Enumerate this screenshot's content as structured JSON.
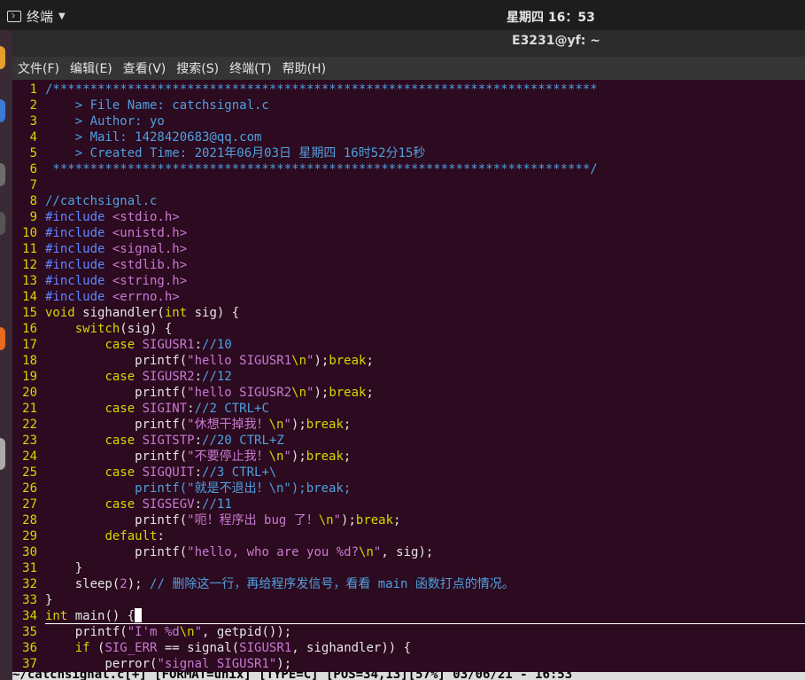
{
  "topbar": {
    "app_label": "终端",
    "clock": "星期四 16：53"
  },
  "window": {
    "title": "E3231@yf: ~"
  },
  "menu": [
    "文件(F)",
    "编辑(E)",
    "查看(V)",
    "搜索(S)",
    "终端(T)",
    "帮助(H)"
  ],
  "colors": {
    "comment": "#4fa0e0",
    "preproc": "#5f87ff",
    "string": "#c87ad2",
    "keyword": "#d7d700",
    "type": "#5fafff",
    "plain": "#e6e6e6",
    "linenum": "#d7d700"
  },
  "editor": {
    "lines": [
      {
        "n": "1",
        "t": [
          {
            "c": "comment",
            "s": "/*************************************************************************"
          }
        ]
      },
      {
        "n": "2",
        "t": [
          {
            "c": "comment",
            "s": "    > File Name: catchsignal.c"
          }
        ]
      },
      {
        "n": "3",
        "t": [
          {
            "c": "comment",
            "s": "    > Author: yo"
          }
        ]
      },
      {
        "n": "4",
        "t": [
          {
            "c": "comment",
            "s": "    > Mail: 1428420683@qq.com"
          }
        ]
      },
      {
        "n": "5",
        "t": [
          {
            "c": "comment",
            "s": "    > Created Time: 2021年06月03日 星期四 16时52分15秒"
          }
        ]
      },
      {
        "n": "6",
        "t": [
          {
            "c": "comment",
            "s": " ************************************************************************/"
          }
        ]
      },
      {
        "n": "7",
        "t": []
      },
      {
        "n": "8",
        "t": [
          {
            "c": "comment",
            "s": "//catchsignal.c"
          }
        ]
      },
      {
        "n": "9",
        "t": [
          {
            "c": "preproc",
            "s": "#include "
          },
          {
            "c": "string",
            "s": "<stdio.h>"
          }
        ]
      },
      {
        "n": "10",
        "t": [
          {
            "c": "preproc",
            "s": "#include "
          },
          {
            "c": "string",
            "s": "<unistd.h>"
          }
        ]
      },
      {
        "n": "11",
        "t": [
          {
            "c": "preproc",
            "s": "#include "
          },
          {
            "c": "string",
            "s": "<signal.h>"
          }
        ]
      },
      {
        "n": "12",
        "t": [
          {
            "c": "preproc",
            "s": "#include "
          },
          {
            "c": "string",
            "s": "<stdlib.h>"
          }
        ]
      },
      {
        "n": "13",
        "t": [
          {
            "c": "preproc",
            "s": "#include "
          },
          {
            "c": "string",
            "s": "<string.h>"
          }
        ]
      },
      {
        "n": "14",
        "t": [
          {
            "c": "preproc",
            "s": "#include "
          },
          {
            "c": "string",
            "s": "<errno.h>"
          }
        ]
      },
      {
        "n": "15",
        "t": [
          {
            "c": "keyword",
            "s": "void"
          },
          {
            "c": "plain",
            "s": " sighandler("
          },
          {
            "c": "keyword",
            "s": "int"
          },
          {
            "c": "plain",
            "s": " sig) {"
          }
        ]
      },
      {
        "n": "16",
        "t": [
          {
            "c": "plain",
            "s": "    "
          },
          {
            "c": "keyword",
            "s": "switch"
          },
          {
            "c": "plain",
            "s": "(sig) {"
          }
        ]
      },
      {
        "n": "17",
        "t": [
          {
            "c": "plain",
            "s": "        "
          },
          {
            "c": "keyword",
            "s": "case"
          },
          {
            "c": "plain",
            "s": " "
          },
          {
            "c": "string",
            "s": "SIGUSR1"
          },
          {
            "c": "plain",
            "s": ":"
          },
          {
            "c": "comment",
            "s": "//10"
          }
        ]
      },
      {
        "n": "18",
        "t": [
          {
            "c": "plain",
            "s": "            printf("
          },
          {
            "c": "string",
            "s": "\"hello SIGUSR1"
          },
          {
            "c": "keyword",
            "s": "\\n"
          },
          {
            "c": "string",
            "s": "\""
          },
          {
            "c": "plain",
            "s": ");"
          },
          {
            "c": "keyword",
            "s": "break"
          },
          {
            "c": "plain",
            "s": ";"
          }
        ]
      },
      {
        "n": "19",
        "t": [
          {
            "c": "plain",
            "s": "        "
          },
          {
            "c": "keyword",
            "s": "case"
          },
          {
            "c": "plain",
            "s": " "
          },
          {
            "c": "string",
            "s": "SIGUSR2"
          },
          {
            "c": "plain",
            "s": ":"
          },
          {
            "c": "comment",
            "s": "//12"
          }
        ]
      },
      {
        "n": "20",
        "t": [
          {
            "c": "plain",
            "s": "            printf("
          },
          {
            "c": "string",
            "s": "\"hello SIGUSR2"
          },
          {
            "c": "keyword",
            "s": "\\n"
          },
          {
            "c": "string",
            "s": "\""
          },
          {
            "c": "plain",
            "s": ");"
          },
          {
            "c": "keyword",
            "s": "break"
          },
          {
            "c": "plain",
            "s": ";"
          }
        ]
      },
      {
        "n": "21",
        "t": [
          {
            "c": "plain",
            "s": "        "
          },
          {
            "c": "keyword",
            "s": "case"
          },
          {
            "c": "plain",
            "s": " "
          },
          {
            "c": "string",
            "s": "SIGINT"
          },
          {
            "c": "plain",
            "s": ":"
          },
          {
            "c": "comment",
            "s": "//2 CTRL+C"
          }
        ]
      },
      {
        "n": "22",
        "t": [
          {
            "c": "plain",
            "s": "            printf("
          },
          {
            "c": "string",
            "s": "\"休想干掉我！"
          },
          {
            "c": "keyword",
            "s": "\\n"
          },
          {
            "c": "string",
            "s": "\""
          },
          {
            "c": "plain",
            "s": ");"
          },
          {
            "c": "keyword",
            "s": "break"
          },
          {
            "c": "plain",
            "s": ";"
          }
        ]
      },
      {
        "n": "23",
        "t": [
          {
            "c": "plain",
            "s": "        "
          },
          {
            "c": "keyword",
            "s": "case"
          },
          {
            "c": "plain",
            "s": " "
          },
          {
            "c": "string",
            "s": "SIGTSTP"
          },
          {
            "c": "plain",
            "s": ":"
          },
          {
            "c": "comment",
            "s": "//20 CTRL+Z"
          }
        ]
      },
      {
        "n": "24",
        "t": [
          {
            "c": "plain",
            "s": "            printf("
          },
          {
            "c": "string",
            "s": "\"不要停止我！"
          },
          {
            "c": "keyword",
            "s": "\\n"
          },
          {
            "c": "string",
            "s": "\""
          },
          {
            "c": "plain",
            "s": ");"
          },
          {
            "c": "keyword",
            "s": "break"
          },
          {
            "c": "plain",
            "s": ";"
          }
        ]
      },
      {
        "n": "25",
        "t": [
          {
            "c": "plain",
            "s": "        "
          },
          {
            "c": "keyword",
            "s": "case"
          },
          {
            "c": "plain",
            "s": " "
          },
          {
            "c": "string",
            "s": "SIGQUIT"
          },
          {
            "c": "plain",
            "s": ":"
          },
          {
            "c": "comment",
            "s": "//3 CTRL+\\"
          }
        ]
      },
      {
        "n": "26",
        "t": [
          {
            "c": "comment",
            "s": "            printf(\"就是不退出！\\n\");break;"
          }
        ]
      },
      {
        "n": "27",
        "t": [
          {
            "c": "plain",
            "s": "        "
          },
          {
            "c": "keyword",
            "s": "case"
          },
          {
            "c": "plain",
            "s": " "
          },
          {
            "c": "string",
            "s": "SIGSEGV"
          },
          {
            "c": "plain",
            "s": ":"
          },
          {
            "c": "comment",
            "s": "//11"
          }
        ]
      },
      {
        "n": "28",
        "t": [
          {
            "c": "plain",
            "s": "            printf("
          },
          {
            "c": "string",
            "s": "\"呃！程序出 bug 了！"
          },
          {
            "c": "keyword",
            "s": "\\n"
          },
          {
            "c": "string",
            "s": "\""
          },
          {
            "c": "plain",
            "s": ");"
          },
          {
            "c": "keyword",
            "s": "break"
          },
          {
            "c": "plain",
            "s": ";"
          }
        ]
      },
      {
        "n": "29",
        "t": [
          {
            "c": "plain",
            "s": "        "
          },
          {
            "c": "keyword",
            "s": "default"
          },
          {
            "c": "plain",
            "s": ":"
          }
        ]
      },
      {
        "n": "30",
        "t": [
          {
            "c": "plain",
            "s": "            printf("
          },
          {
            "c": "string",
            "s": "\"hello, who are you %d?"
          },
          {
            "c": "keyword",
            "s": "\\n"
          },
          {
            "c": "string",
            "s": "\""
          },
          {
            "c": "plain",
            "s": ", sig);"
          }
        ]
      },
      {
        "n": "31",
        "t": [
          {
            "c": "plain",
            "s": "    }"
          }
        ]
      },
      {
        "n": "32",
        "t": [
          {
            "c": "plain",
            "s": "    sleep("
          },
          {
            "c": "string",
            "s": "2"
          },
          {
            "c": "plain",
            "s": "); "
          },
          {
            "c": "comment",
            "s": "// 删除这一行，再给程序发信号，看看 main 函数打点的情况。"
          }
        ]
      },
      {
        "n": "33",
        "t": [
          {
            "c": "plain",
            "s": "}"
          }
        ]
      },
      {
        "n": "34",
        "t": [
          {
            "c": "keyword",
            "s": "int"
          },
          {
            "c": "plain",
            "s": " main() {"
          }
        ],
        "cursor": true
      },
      {
        "n": "35",
        "t": [
          {
            "c": "plain",
            "s": "    printf("
          },
          {
            "c": "string",
            "s": "\"I'm %d"
          },
          {
            "c": "keyword",
            "s": "\\n"
          },
          {
            "c": "string",
            "s": "\""
          },
          {
            "c": "plain",
            "s": ", getpid());"
          }
        ]
      },
      {
        "n": "36",
        "t": [
          {
            "c": "plain",
            "s": "    "
          },
          {
            "c": "keyword",
            "s": "if"
          },
          {
            "c": "plain",
            "s": " ("
          },
          {
            "c": "string",
            "s": "SIG_ERR"
          },
          {
            "c": "plain",
            "s": " == signal("
          },
          {
            "c": "string",
            "s": "SIGUSR1"
          },
          {
            "c": "plain",
            "s": ", sighandler)) {"
          }
        ]
      },
      {
        "n": "37",
        "t": [
          {
            "c": "plain",
            "s": "        perror("
          },
          {
            "c": "string",
            "s": "\"signal SIGUSR1\""
          },
          {
            "c": "plain",
            "s": ");"
          }
        ]
      }
    ]
  },
  "status": {
    "text": "~/catchsignal.c[+] [FORMAT=unix] [TYPE=C] [POS=34,13][57%] 03/06/21 - 16:53"
  }
}
